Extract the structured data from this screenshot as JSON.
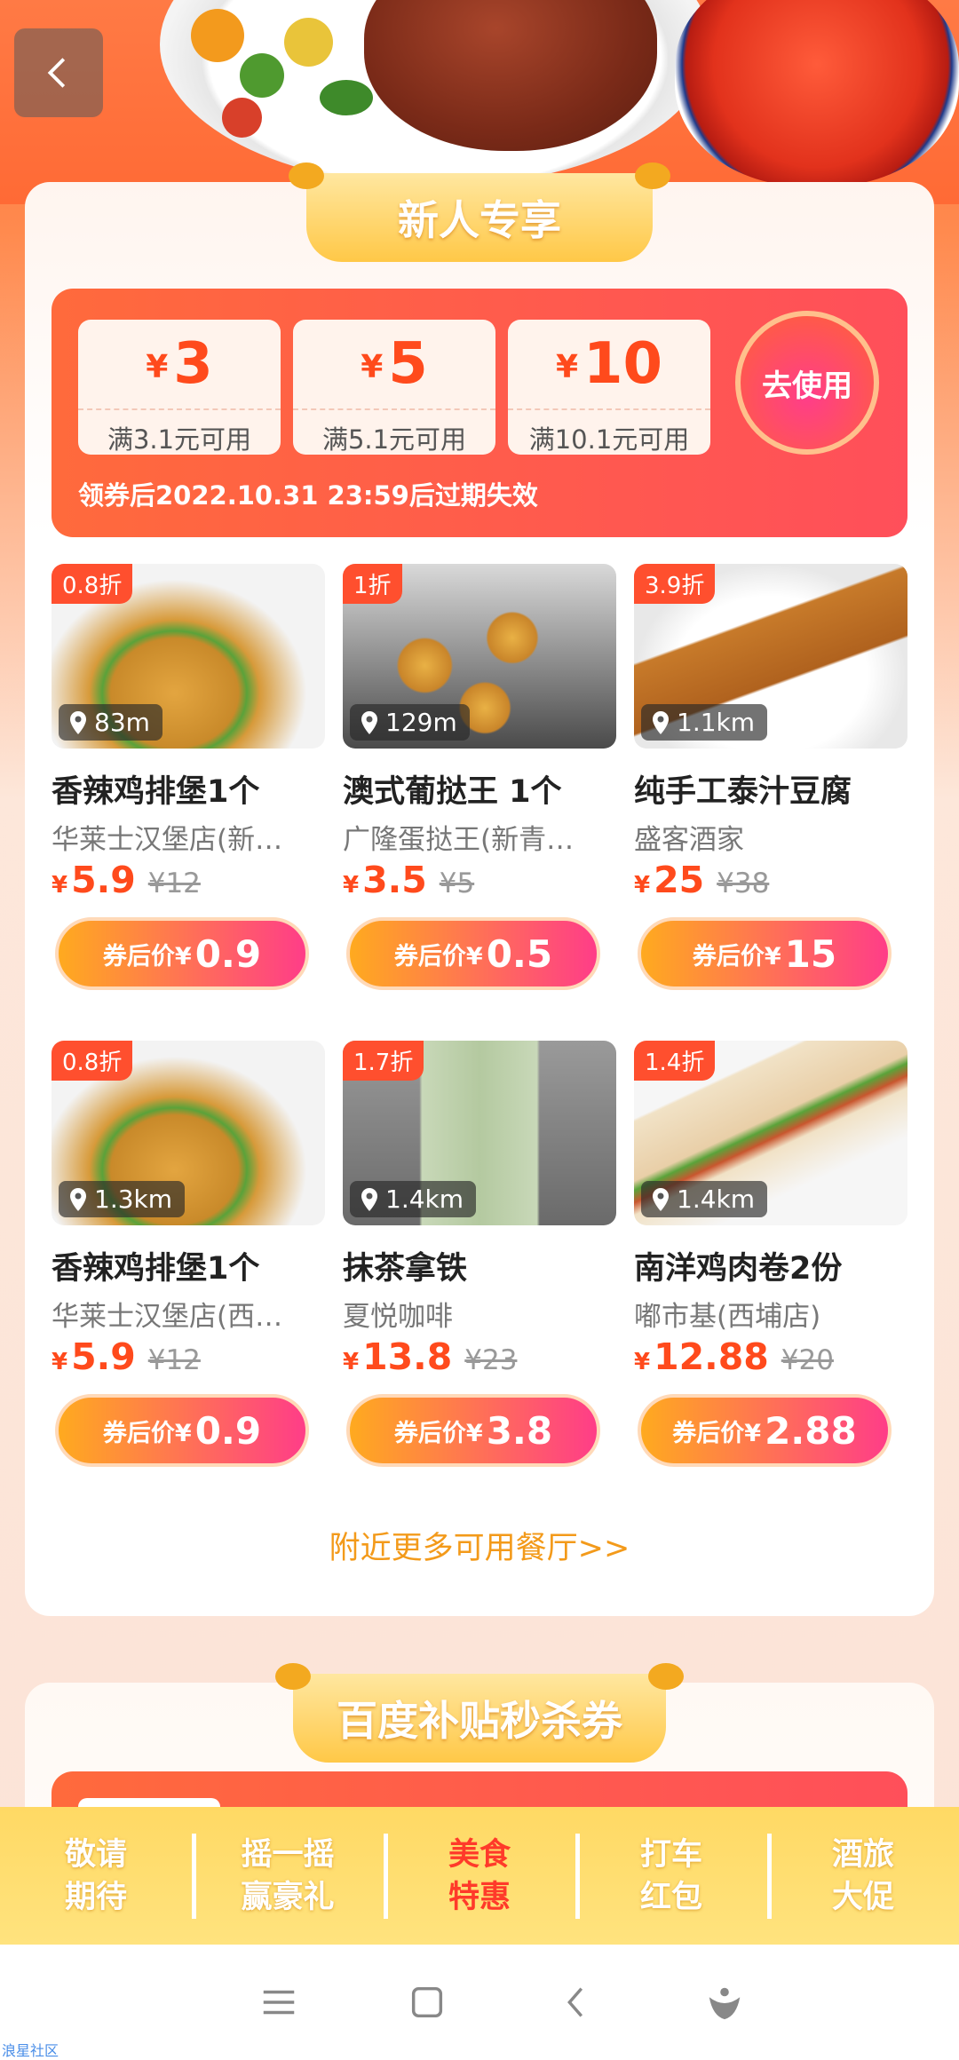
{
  "newcomer": {
    "title": "新人专享",
    "coupons": [
      {
        "yen": "¥",
        "amount": "3",
        "rule": "满3.1元可用"
      },
      {
        "yen": "¥",
        "amount": "5",
        "rule": "满5.1元可用"
      },
      {
        "yen": "¥",
        "amount": "10",
        "rule": "满10.1元可用"
      }
    ],
    "use_button": "去使用",
    "expire_text": "领券后2022.10.31 23:59后过期失效"
  },
  "items": [
    {
      "discount": "0.8折",
      "distance": "83m",
      "name": "香辣鸡排堡1个",
      "shop": "华莱士汉堡店(新…",
      "yen": "¥",
      "price": "5.9",
      "orig": "¥12",
      "after_label": "券后价¥",
      "after_price": "0.9"
    },
    {
      "discount": "1折",
      "distance": "129m",
      "name": "澳式葡挞王 1个",
      "shop": "广隆蛋挞王(新青…",
      "yen": "¥",
      "price": "3.5",
      "orig": "¥5",
      "after_label": "券后价¥",
      "after_price": "0.5"
    },
    {
      "discount": "3.9折",
      "distance": "1.1km",
      "name": "纯手工泰汁豆腐",
      "shop": "盛客酒家",
      "yen": "¥",
      "price": "25",
      "orig": "¥38",
      "after_label": "券后价¥",
      "after_price": "15"
    },
    {
      "discount": "0.8折",
      "distance": "1.3km",
      "name": "香辣鸡排堡1个",
      "shop": "华莱士汉堡店(西…",
      "yen": "¥",
      "price": "5.9",
      "orig": "¥12",
      "after_label": "券后价¥",
      "after_price": "0.9"
    },
    {
      "discount": "1.7折",
      "distance": "1.4km",
      "name": "抹茶拿铁",
      "shop": "夏悦咖啡",
      "yen": "¥",
      "price": "13.8",
      "orig": "¥23",
      "after_label": "券后价¥",
      "after_price": "3.8"
    },
    {
      "discount": "1.4折",
      "distance": "1.4km",
      "name": "南洋鸡肉卷2份",
      "shop": "嘟市基(西埔店)",
      "yen": "¥",
      "price": "12.88",
      "orig": "¥20",
      "after_label": "券后价¥",
      "after_price": "2.88"
    }
  ],
  "more_link": "附近更多可用餐厅>>",
  "subsidy": {
    "title": "百度补贴秒杀券"
  },
  "tabs": [
    {
      "line1": "敬请",
      "line2": "期待"
    },
    {
      "line1": "摇一摇",
      "line2": "赢豪礼"
    },
    {
      "line1": "美食",
      "line2": "特惠"
    },
    {
      "line1": "打车",
      "line2": "红包"
    },
    {
      "line1": "酒旅",
      "line2": "大促"
    }
  ],
  "watermark": "浪星社区",
  "colors": {
    "accent": "#ff4a1c",
    "tab_active": "#ff3a2a",
    "tabbar_bg": "#ffd964",
    "link": "#f39a1a"
  },
  "icons": [
    "back-icon",
    "location-pin-icon",
    "menu-icon",
    "home-icon",
    "back-nav-icon",
    "assistant-icon"
  ]
}
